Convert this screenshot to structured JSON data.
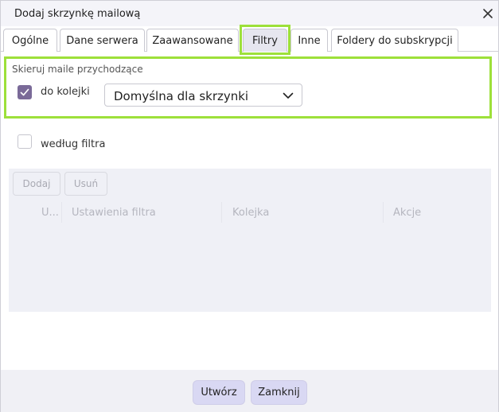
{
  "dialog": {
    "title": "Dodaj skrzynkę mailową"
  },
  "tabs": [
    {
      "label": "Ogólne"
    },
    {
      "label": "Dane serwera"
    },
    {
      "label": "Zaawansowane"
    },
    {
      "label": "Filtry",
      "active": true
    },
    {
      "label": "Inne"
    },
    {
      "label": "Foldery do subskrypcji"
    }
  ],
  "routing": {
    "section_title": "Skieruj maile przychodzące",
    "to_queue": {
      "label": "do kolejki",
      "checked": true
    },
    "queue_select": {
      "value": "Domyślna dla skrzynki"
    },
    "by_filter": {
      "label": "według filtra",
      "checked": false
    }
  },
  "filters": {
    "add_label": "Dodaj",
    "remove_label": "Usuń",
    "columns": [
      "U...",
      "Ustawienia filtra",
      "Kolejka",
      "Akcje"
    ]
  },
  "footer": {
    "create_label": "Utwórz",
    "close_label": "Zamknij"
  },
  "colors": {
    "highlight": "#9de03a",
    "checkbox_checked": "#7a6a98",
    "button_primary": "#d9d8f3"
  }
}
